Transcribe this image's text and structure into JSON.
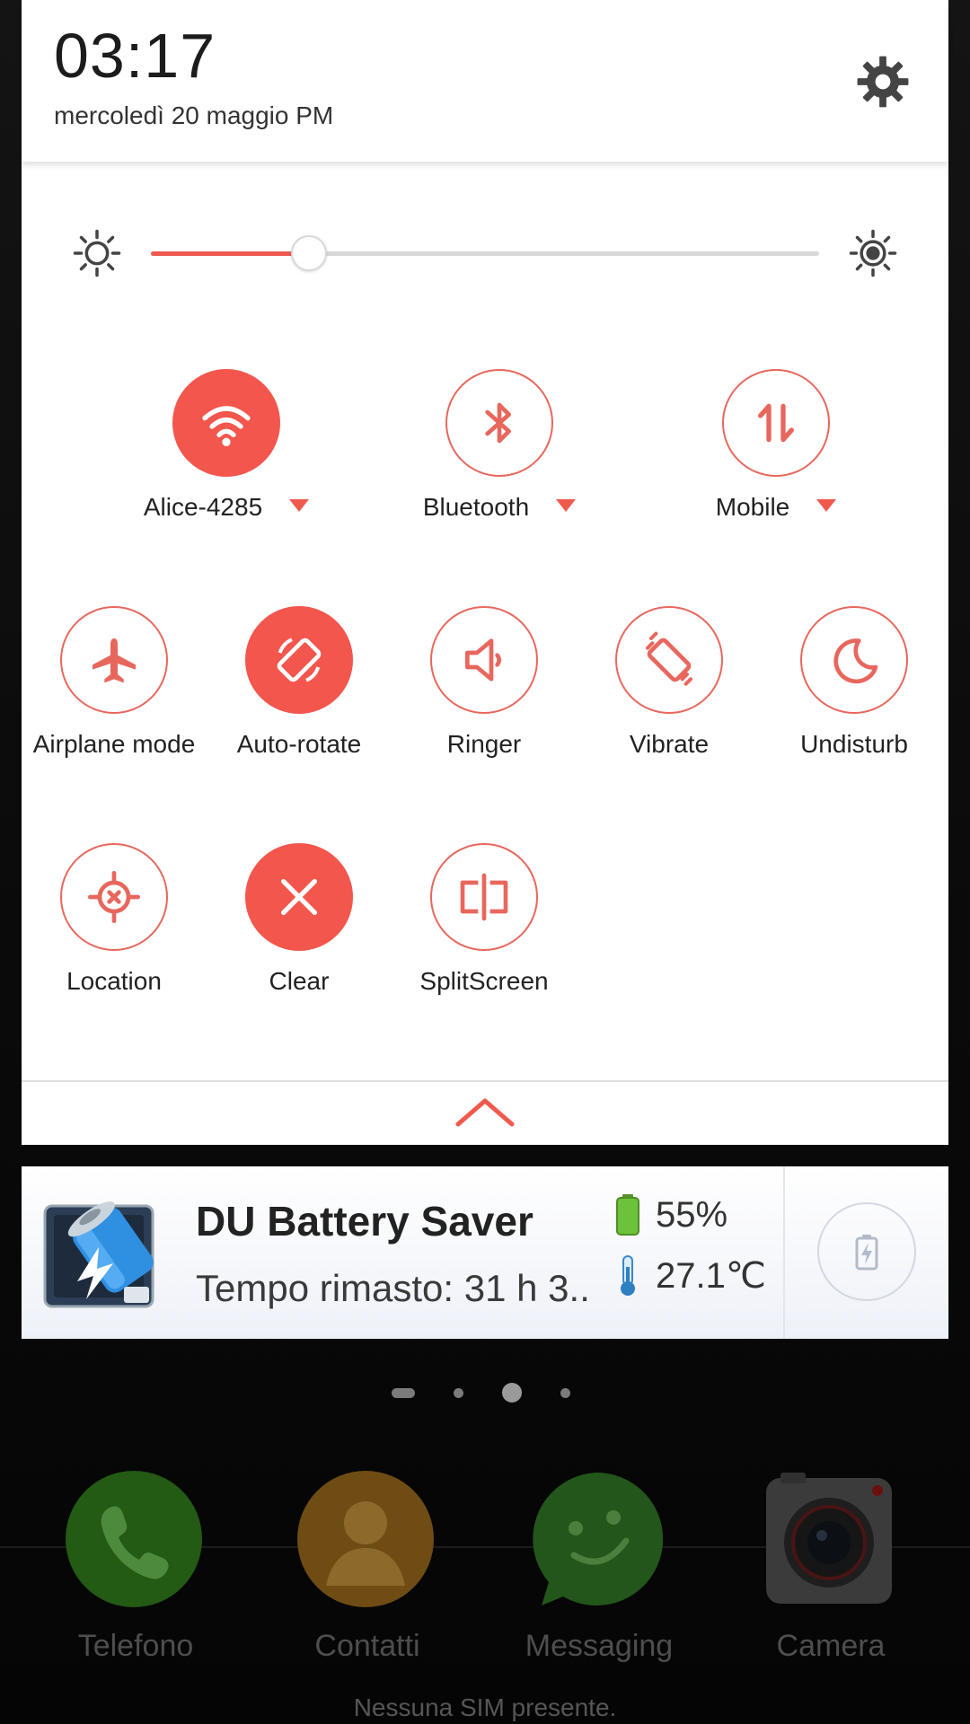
{
  "header": {
    "time": "03:17",
    "date": "mercoledì 20 maggio PM"
  },
  "brightness": {
    "level": 0.236
  },
  "tiles": [
    {
      "label": "Alice-4285",
      "icon": "wifi-icon",
      "active": true,
      "dropdown": true
    },
    {
      "label": "Bluetooth",
      "icon": "bluetooth-icon",
      "active": false,
      "dropdown": true
    },
    {
      "label": "Mobile",
      "icon": "mobile-data-icon",
      "active": false,
      "dropdown": true
    },
    {
      "label": "Airplane mode",
      "icon": "airplane-icon",
      "active": false
    },
    {
      "label": "Auto-rotate",
      "icon": "auto-rotate-icon",
      "active": true
    },
    {
      "label": "Ringer",
      "icon": "speaker-icon",
      "active": false
    },
    {
      "label": "Vibrate",
      "icon": "vibrate-icon",
      "active": false
    },
    {
      "label": "Undisturb",
      "icon": "moon-icon",
      "active": false
    },
    {
      "label": "Location",
      "icon": "location-icon",
      "active": false
    },
    {
      "label": "Clear",
      "icon": "close-icon",
      "active": true
    },
    {
      "label": "SplitScreen",
      "icon": "split-screen-icon",
      "active": false
    }
  ],
  "notification": {
    "title": "DU Battery Saver",
    "subtitle": "Tempo rimasto: 31 h 3..",
    "battery": "55%",
    "temperature": "27.1℃",
    "app_icon": "battery-saver-app-icon",
    "action_icon": "battery-charging-icon"
  },
  "dock": {
    "apps": [
      {
        "label": "Telefono",
        "icon": "phone-icon"
      },
      {
        "label": "Contatti",
        "icon": "contacts-icon"
      },
      {
        "label": "Messaging",
        "icon": "messaging-icon"
      },
      {
        "label": "Camera",
        "icon": "camera-icon"
      }
    ],
    "sim_status": "Nessuna SIM presente."
  },
  "colors": {
    "accent": "#f3564c",
    "outline": "#e8675d"
  }
}
